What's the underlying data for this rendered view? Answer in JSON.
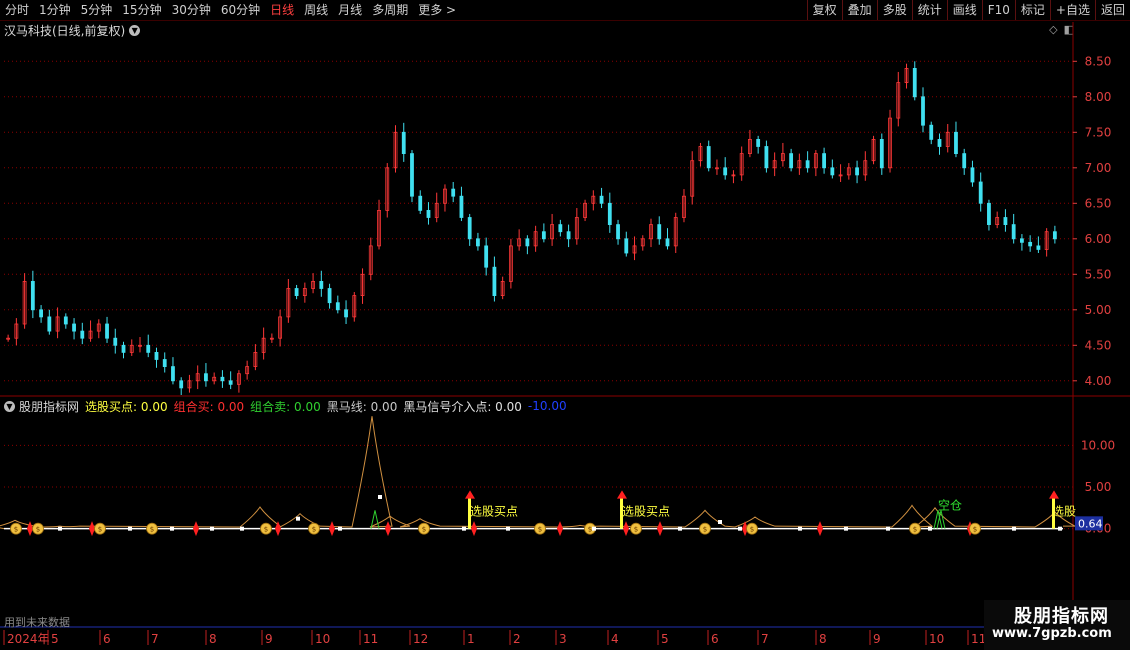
{
  "toolbar": {
    "periods": [
      "分时",
      "1分钟",
      "5分钟",
      "15分钟",
      "30分钟",
      "60分钟",
      "日线",
      "周线",
      "月线",
      "多周期",
      "更多 >"
    ],
    "active_period": "日线",
    "actions": [
      "复权",
      "叠加",
      "多股",
      "统计",
      "画线",
      "F10",
      "标记",
      "+自选",
      "返回"
    ]
  },
  "stock": {
    "title": "汉马科技(日线,前复权)"
  },
  "price_axis": {
    "labels": [
      "8.50",
      "8.00",
      "7.50",
      "7.00",
      "6.50",
      "6.00",
      "5.50",
      "5.00",
      "4.50",
      "4.00"
    ]
  },
  "indicator": {
    "name": "股朋指标网",
    "legend": [
      {
        "text": "选股买点: 0.00",
        "color": "#ffff40"
      },
      {
        "text": "组合买: 0.00",
        "color": "#ff3030"
      },
      {
        "text": "组合卖: 0.00",
        "color": "#30d030"
      },
      {
        "text": "黑马线: 0.00",
        "color": "#c8c8c8"
      },
      {
        "text": "黑马信号介入点: 0.00",
        "color": "#e0e0e0"
      },
      {
        "text": "-10.00",
        "color": "#2040ff"
      }
    ],
    "axis_labels": [
      "10.00",
      "5.00",
      "0.00"
    ],
    "current_value": "0.64",
    "annotations": [
      {
        "text": "选股买点",
        "color": "#ffff40"
      },
      {
        "text": "选股买点",
        "color": "#ffff40"
      },
      {
        "text": "空仓",
        "color": "#30e030"
      },
      {
        "text": "选股",
        "color": "#ffff40"
      }
    ]
  },
  "note": "用到未来数据",
  "time_axis": {
    "labels": [
      "2024年",
      "5",
      "6",
      "7",
      "8",
      "9",
      "10",
      "11",
      "12",
      "1",
      "2",
      "3",
      "4",
      "5",
      "6",
      "7",
      "8",
      "9",
      "10",
      "11"
    ]
  },
  "watermark": {
    "line1": "股朋指标网",
    "line2": "www.7gpzb.com"
  },
  "colors": {
    "up": "#ff3838",
    "down": "#40e0f0",
    "grid": "#8b0000",
    "axis_text": "#e04040",
    "white_line": "#ffffff",
    "orange_line": "#d09040"
  },
  "chart_data": {
    "type": "line",
    "title": "",
    "close_prices": [
      4.6,
      4.8,
      5.4,
      5.0,
      4.9,
      4.7,
      4.9,
      4.8,
      4.7,
      4.6,
      4.7,
      4.8,
      4.6,
      4.5,
      4.4,
      4.5,
      4.5,
      4.4,
      4.3,
      4.2,
      4.0,
      3.9,
      4.0,
      4.1,
      4.0,
      4.05,
      4.0,
      3.95,
      4.1,
      4.2,
      4.4,
      4.6,
      4.6,
      4.9,
      5.3,
      5.2,
      5.3,
      5.4,
      5.3,
      5.1,
      5.0,
      4.9,
      5.2,
      5.5,
      5.9,
      6.4,
      7.0,
      7.5,
      7.2,
      6.6,
      6.4,
      6.3,
      6.5,
      6.7,
      6.6,
      6.3,
      6.0,
      5.9,
      5.6,
      5.2,
      5.4,
      5.9,
      6.0,
      5.9,
      6.1,
      6.0,
      6.2,
      6.1,
      6.0,
      6.3,
      6.5,
      6.6,
      6.5,
      6.2,
      6.0,
      5.8,
      5.9,
      6.0,
      6.2,
      6.0,
      5.9,
      6.3,
      6.6,
      7.1,
      7.3,
      7.0,
      7.0,
      6.9,
      6.9,
      7.2,
      7.4,
      7.3,
      7.0,
      7.1,
      7.2,
      7.0,
      7.1,
      7.0,
      7.2,
      7.0,
      6.9,
      6.9,
      7.0,
      6.9,
      7.1,
      7.4,
      7.0,
      7.7,
      8.2,
      8.4,
      8.0,
      7.6,
      7.4,
      7.3,
      7.5,
      7.2,
      7.0,
      6.8,
      6.5,
      6.2,
      6.3,
      6.2,
      6.0,
      5.95,
      5.9,
      5.85,
      6.1,
      6.0
    ],
    "ylim": [
      3.8,
      8.8
    ],
    "indicator_ylim": [
      -10,
      14
    ]
  }
}
